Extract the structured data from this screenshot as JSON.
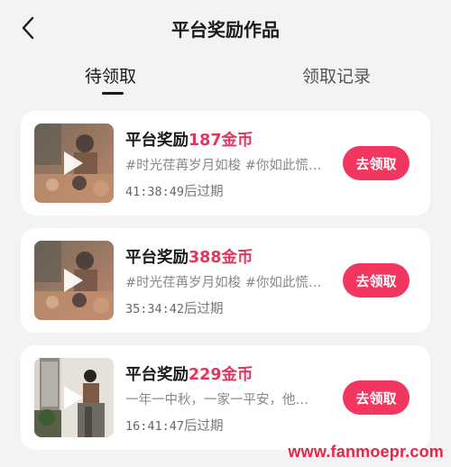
{
  "header": {
    "title": "平台奖励作品",
    "back_icon": "chevron-left-icon"
  },
  "tabs": [
    {
      "label": "待领取",
      "active": true
    },
    {
      "label": "领取记录",
      "active": false
    }
  ],
  "cards": [
    {
      "title_prefix": "平台奖励",
      "amount": "187金币",
      "description": "#时光荏苒岁月如梭 #你如此慌…",
      "timer": "41:38:49",
      "timer_suffix": "后过期",
      "button_label": "去领取"
    },
    {
      "title_prefix": "平台奖励",
      "amount": "388金币",
      "description": "#时光荏苒岁月如梭 #你如此慌…",
      "timer": "35:34:42",
      "timer_suffix": "后过期",
      "button_label": "去领取"
    },
    {
      "title_prefix": "平台奖励",
      "amount": "229金币",
      "description": "一年一中秋，一家一平安，他…",
      "timer": "16:41:47",
      "timer_suffix": "后过期",
      "button_label": "去领取"
    }
  ],
  "watermark": "www.fanmoepr.com",
  "colors": {
    "accent": "#f2365f",
    "amount": "#e8335c",
    "background": "#f3f3f3",
    "card": "#ffffff"
  }
}
